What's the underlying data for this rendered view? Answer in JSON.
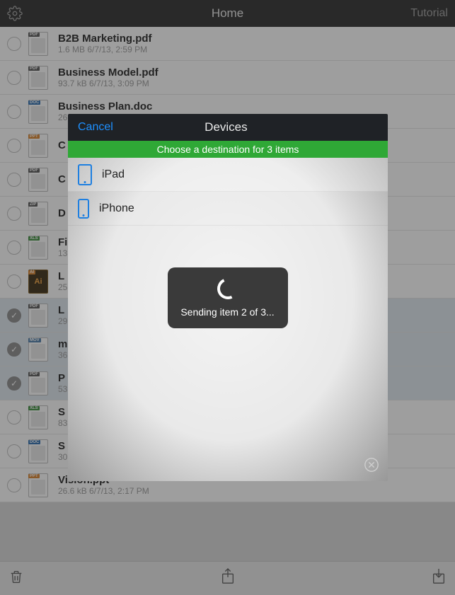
{
  "nav": {
    "title": "Home",
    "right": "Tutorial"
  },
  "files": [
    {
      "name": "B2B Marketing.pdf",
      "meta": "1.6 MB 6/7/13, 2:59 PM",
      "type": "pdf",
      "selected": false
    },
    {
      "name": "Business Model.pdf",
      "meta": "93.7 kB 6/7/13, 3:09 PM",
      "type": "pdf",
      "selected": false
    },
    {
      "name": "Business Plan.doc",
      "meta": "26",
      "type": "doc",
      "selected": false
    },
    {
      "name": "C",
      "meta": "",
      "type": "ppt",
      "selected": false
    },
    {
      "name": "C",
      "meta": "",
      "type": "pdf",
      "selected": false
    },
    {
      "name": "D",
      "meta": "",
      "type": "zip",
      "selected": false
    },
    {
      "name": "Fi",
      "meta": "13",
      "type": "xls",
      "selected": false
    },
    {
      "name": "L",
      "meta": "25",
      "type": "ai",
      "selected": false
    },
    {
      "name": "L",
      "meta": "29",
      "type": "pdf",
      "selected": true
    },
    {
      "name": "m",
      "meta": "36",
      "type": "mov",
      "selected": true
    },
    {
      "name": "P",
      "meta": "53",
      "type": "pdf",
      "selected": true
    },
    {
      "name": "S",
      "meta": "83",
      "type": "xls",
      "selected": false
    },
    {
      "name": "S",
      "meta": "30",
      "type": "doc",
      "selected": false
    },
    {
      "name": "Vision.ppt",
      "meta": "26.6 kB 6/7/13, 2:17 PM",
      "type": "ppt",
      "selected": false
    }
  ],
  "modal": {
    "cancel": "Cancel",
    "title": "Devices",
    "banner": "Choose a destination for 3 items",
    "devices": [
      {
        "label": "iPad",
        "kind": "tablet"
      },
      {
        "label": "iPhone",
        "kind": "phone"
      }
    ]
  },
  "hud": {
    "text": "Sending item 2 of 3..."
  }
}
